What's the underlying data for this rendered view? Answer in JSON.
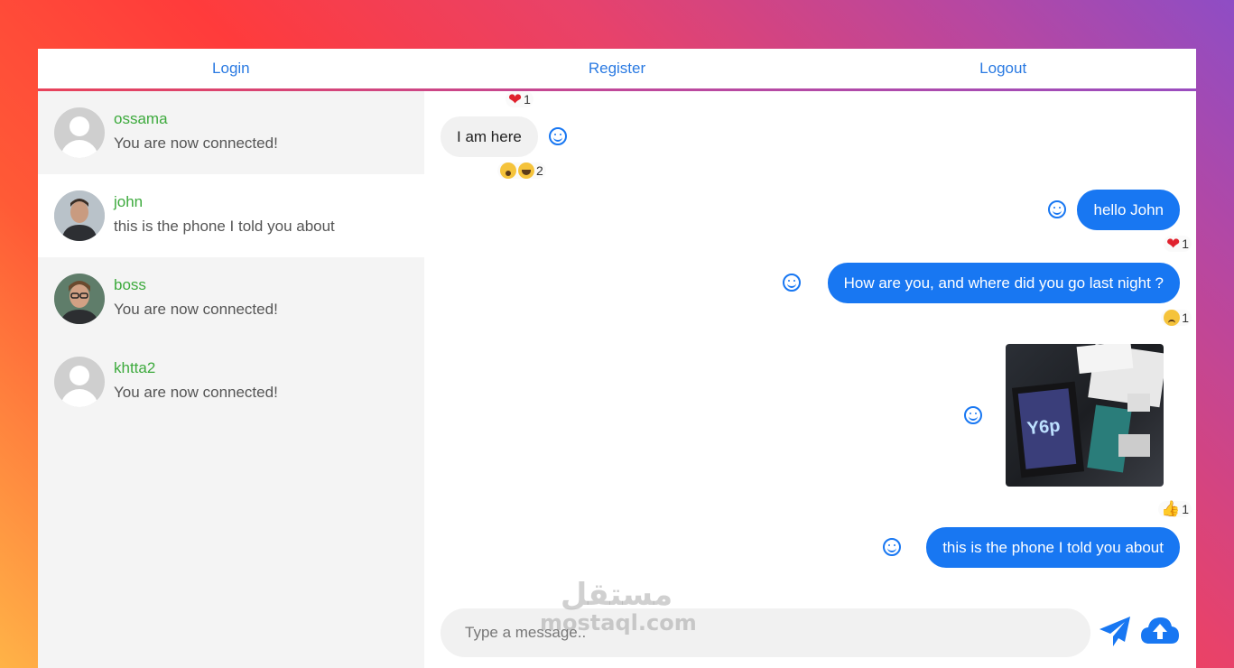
{
  "nav": {
    "login": "Login",
    "register": "Register",
    "logout": "Logout"
  },
  "contacts": [
    {
      "name": "ossama",
      "last": "You are now connected!",
      "avatar": "default-avatar"
    },
    {
      "name": "john",
      "last": "this is the phone I told you about",
      "avatar": "photo-avatar"
    },
    {
      "name": "boss",
      "last": "You are now connected!",
      "avatar": "photo-avatar"
    },
    {
      "name": "khtta2",
      "last": "You are now connected!",
      "avatar": "default-avatar"
    }
  ],
  "messages": [
    {
      "dir": "in",
      "text": "I am here",
      "reactions_above": {
        "emoji": "heart",
        "count": "1"
      },
      "reactions": {
        "emoji": [
          "wow",
          "laugh"
        ],
        "count": "2"
      }
    },
    {
      "dir": "out",
      "text": "hello John",
      "reactions": {
        "emoji": [
          "heart"
        ],
        "count": "1"
      }
    },
    {
      "dir": "out",
      "text": "How are you, and where did you go last night ?",
      "reactions": {
        "emoji": [
          "sad"
        ],
        "count": "1"
      }
    },
    {
      "dir": "out",
      "type": "image",
      "image": "phone-box-photo",
      "reactions": {
        "emoji": [
          "thumbs-up"
        ],
        "count": "1"
      }
    },
    {
      "dir": "out",
      "text": "this is the phone I told you about"
    }
  ],
  "composer": {
    "placeholder": "Type a message.."
  },
  "icons": {
    "send": "send-icon",
    "upload": "cloud-upload-icon",
    "react": "smile-icon"
  },
  "colors": {
    "accent": "#1877f2",
    "name_green": "#3daa3d",
    "link_blue": "#2a7ae2"
  },
  "watermark": {
    "arabic": "مستقل",
    "latin": "mostaql.com"
  }
}
